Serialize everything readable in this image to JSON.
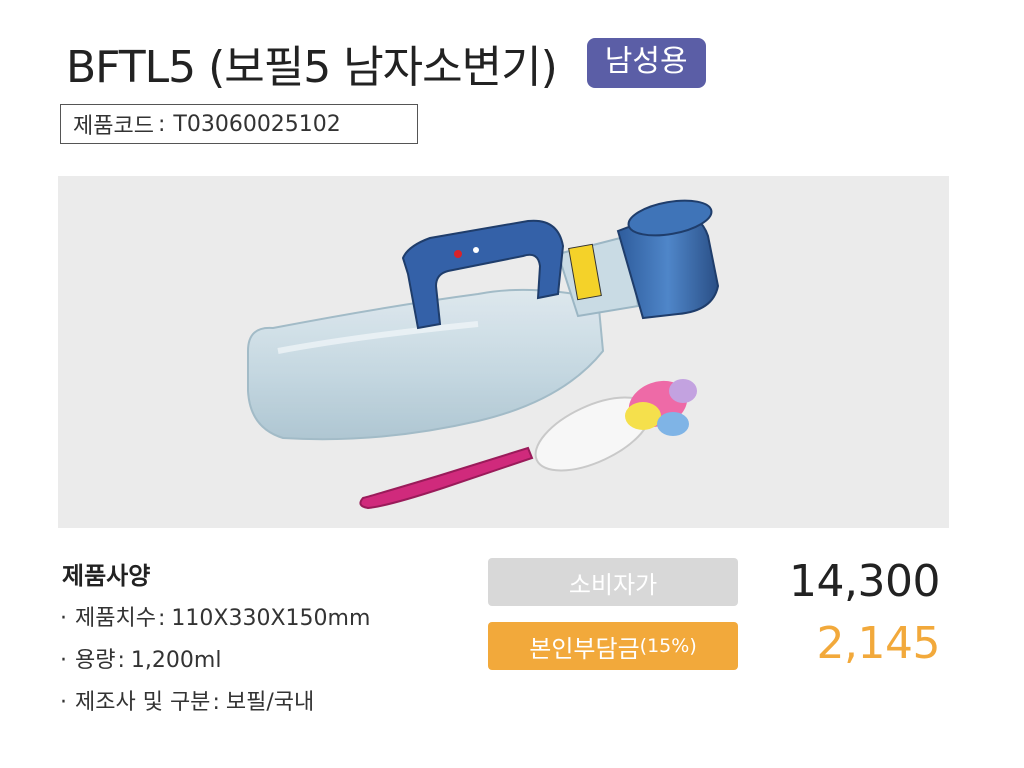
{
  "header": {
    "title": "BFTL5 (보필5 남자소변기)",
    "tag": "남성용",
    "tag_color": "#5b5ea6"
  },
  "product_code": {
    "label": "제품코드",
    "separator": ":",
    "value": "T03060025102"
  },
  "product_image": {
    "description_icon": "urinal-bottle-and-brush-image"
  },
  "specs": {
    "title": "제품사양",
    "items": [
      {
        "label": "제품치수",
        "value": "110X330X150mm"
      },
      {
        "label": "용량",
        "value": "1,200ml"
      },
      {
        "label": "제조사 및 구분",
        "value": "보필/국내"
      }
    ]
  },
  "pricing": {
    "retail_label": "소비자가",
    "retail_value": "14,300",
    "copay_label": "본인부담금",
    "copay_pct": "(15%)",
    "copay_value": "2,145",
    "accent_color": "#f2a93b",
    "retail_badge_color": "#d8d8d8"
  }
}
